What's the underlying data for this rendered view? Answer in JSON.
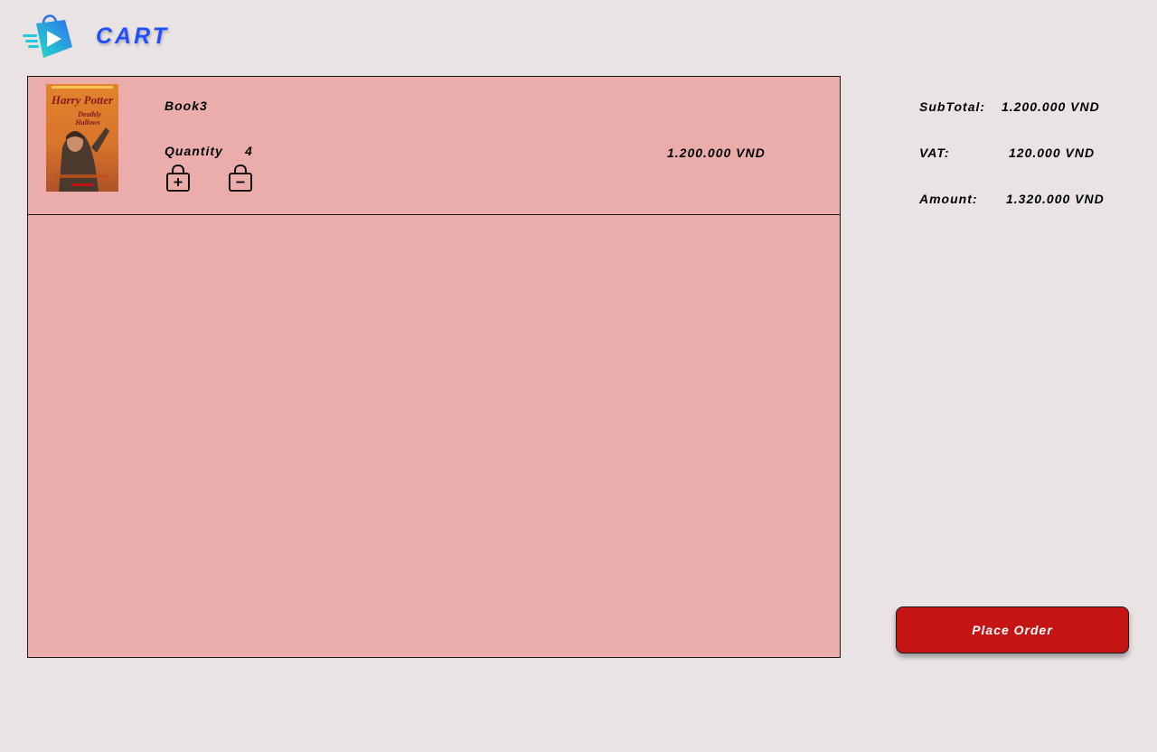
{
  "header": {
    "logo_icon": "shopping-bag-arrow-icon",
    "title": "CART",
    "title_color": "#1f4fff"
  },
  "cart": {
    "panel_color": "#ebadac",
    "items": [
      {
        "name": "Book3",
        "cover_title": "Harry Potter",
        "quantity_label": "Quantity",
        "quantity": "4",
        "price": "1.200.000 VND",
        "add_icon": "bag-plus-icon",
        "remove_icon": "bag-minus-icon"
      }
    ]
  },
  "summary": {
    "subtotal_label": "SubTotal:",
    "subtotal_value": "1.200.000 VND",
    "vat_label": "VAT:",
    "vat_value": "120.000 VND",
    "amount_label": "Amount:",
    "amount_value": "1.320.000 VND"
  },
  "actions": {
    "place_order_label": "Place Order",
    "place_order_color": "#c41414"
  }
}
